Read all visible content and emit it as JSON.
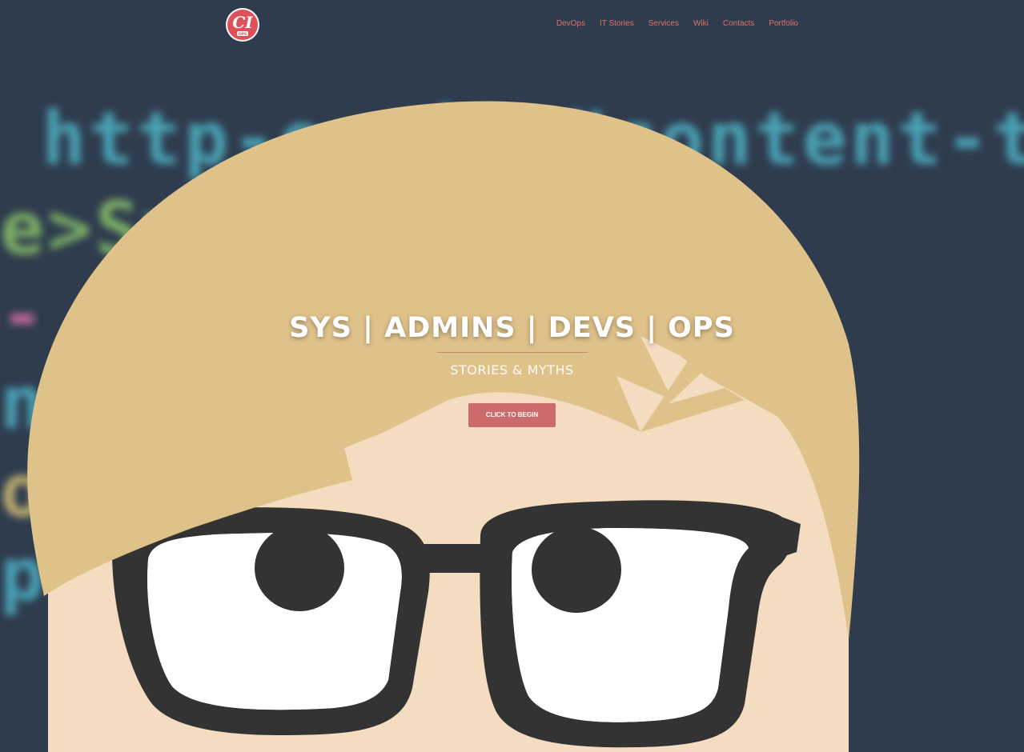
{
  "site": {
    "logo_text": "CI",
    "logo_subtext": "OPS"
  },
  "nav": {
    "items": [
      {
        "label": "DevOps"
      },
      {
        "label": "IT Stories"
      },
      {
        "label": "Services"
      },
      {
        "label": "Wiki"
      },
      {
        "label": "Contacts"
      },
      {
        "label": "Portfolio"
      }
    ]
  },
  "hero": {
    "title": "SYS | ADMINS | DEVS | OPS",
    "subtitle": "STORIES & MYTHS",
    "button_label": "CLICK TO BEGIN"
  },
  "background_code": {
    "lines": [
      {
        "text": "http-equiv=\"content-typ"
      },
      {
        "text": "e>Sy              </title"
      },
      {
        "text": "-                    AFDKO"
      },
      {
        "text": "                     ntent"
      },
      {
        "text": "o                       cod"
      },
      {
        "text": "                     pe=\""
      }
    ]
  },
  "colors": {
    "background": "#2f3c4e",
    "accent": "#cc6b6b",
    "nav_link": "#e0706a",
    "hair": "#dfc28a",
    "skin": "#f3dcc0",
    "glasses": "#333333",
    "code_blue": "#4fb4c8",
    "code_green": "#8cc56a",
    "code_yellow": "#d9c27a",
    "code_pink": "#d96fa6"
  },
  "icons": {
    "logo": "ci-ops-logo"
  }
}
